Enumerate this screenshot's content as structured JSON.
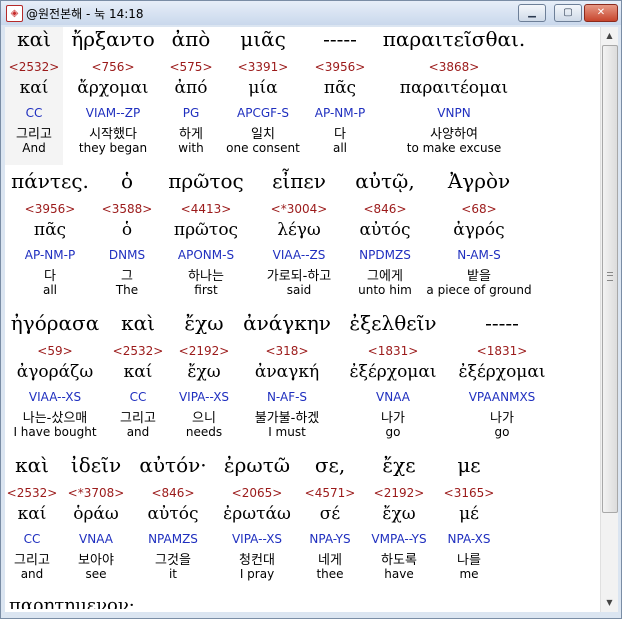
{
  "window": {
    "title": "@원전본해 - 눅 14:18"
  },
  "verses": [
    [
      {
        "greek": "καὶ",
        "num": "<2532>",
        "lemma": "καί",
        "parse": "CC",
        "korean": "그리고",
        "english": "And"
      },
      {
        "greek": "ἤρξαντο",
        "num": "<756>",
        "lemma": "ἄρχομαι",
        "parse": "VIAM--ZP",
        "korean": "시작했다",
        "english": "they began"
      },
      {
        "greek": "ἀπὸ",
        "num": "<575>",
        "lemma": "ἀπό",
        "parse": "PG",
        "korean": "하게",
        "english": "with"
      },
      {
        "greek": "μιᾶς",
        "num": "<3391>",
        "lemma": "μία",
        "parse": "APCGF-S",
        "korean": "일치",
        "english": "one consent"
      },
      {
        "greek": "-----",
        "num": "<3956>",
        "lemma": "πᾶς",
        "parse": "AP-NM-P",
        "korean": "다",
        "english": "all"
      },
      {
        "greek": "παραιτεῖσθαι.",
        "num": "<3868>",
        "lemma": "παραιτέομαι",
        "parse": "VNPN",
        "korean": "사양하여",
        "english": "to make excuse"
      }
    ],
    [
      {
        "greek": "πάντες.",
        "num": "<3956>",
        "lemma": "πᾶς",
        "parse": "AP-NM-P",
        "korean": "다",
        "english": "all"
      },
      {
        "greek": "ὁ",
        "num": "<3588>",
        "lemma": "ὁ",
        "parse": "DNMS",
        "korean": "그",
        "english": "The"
      },
      {
        "greek": "πρῶτος",
        "num": "<4413>",
        "lemma": "πρῶτος",
        "parse": "APONM-S",
        "korean": "하나는",
        "english": "first"
      },
      {
        "greek": "εἶπεν",
        "num": "<*3004>",
        "lemma": "λέγω",
        "parse": "VIAA--ZS",
        "korean": "가로되-하고",
        "english": "said"
      },
      {
        "greek": "αὐτῷ,",
        "num": "<846>",
        "lemma": "αὐτός",
        "parse": "NPDMZS",
        "korean": "그에게",
        "english": "unto him"
      },
      {
        "greek": "Ἀγρὸν",
        "num": "<68>",
        "lemma": "ἀγρός",
        "parse": "N-AM-S",
        "korean": "밭을",
        "english": "a piece of ground"
      }
    ],
    [
      {
        "greek": "ἠγόρασα",
        "num": "<59>",
        "lemma": "ἀγοράζω",
        "parse": "VIAA--XS",
        "korean": "나는-샀으매",
        "english": "I have bought"
      },
      {
        "greek": "καὶ",
        "num": "<2532>",
        "lemma": "καί",
        "parse": "CC",
        "korean": "그리고",
        "english": "and"
      },
      {
        "greek": "ἔχω",
        "num": "<2192>",
        "lemma": "ἔχω",
        "parse": "VIPA--XS",
        "korean": "으니",
        "english": "needs"
      },
      {
        "greek": "ἀνάγκην",
        "num": "<318>",
        "lemma": "ἀναγκή",
        "parse": "N-AF-S",
        "korean": "불가불-하겠",
        "english": "I must"
      },
      {
        "greek": "ἐξελθεῖν",
        "num": "<1831>",
        "lemma": "ἐξέρχομαι",
        "parse": "VNAA",
        "korean": "나가",
        "english": "go"
      },
      {
        "greek": "-----",
        "num": "<1831>",
        "lemma": "ἐξέρχομαι",
        "parse": "VPAANMXS",
        "korean": "나가",
        "english": "go"
      }
    ],
    [
      {
        "greek": "καὶ",
        "num": "<2532>",
        "lemma": "καί",
        "parse": "CC",
        "korean": "그리고",
        "english": "and"
      },
      {
        "greek": "ἰδεῖν",
        "num": "<*3708>",
        "lemma": "ὁράω",
        "parse": "VNAA",
        "korean": "보아야",
        "english": "see"
      },
      {
        "greek": "αὐτόν·",
        "num": "<846>",
        "lemma": "αὐτός",
        "parse": "NPAMZS",
        "korean": "그것을",
        "english": "it"
      },
      {
        "greek": "ἐρωτῶ",
        "num": "<2065>",
        "lemma": "ἐρωτάω",
        "parse": "VIPA--XS",
        "korean": "청컨대",
        "english": "I pray"
      },
      {
        "greek": "σε,",
        "num": "<4571>",
        "lemma": "σέ",
        "parse": "NPA-YS",
        "korean": "네게",
        "english": "thee"
      },
      {
        "greek": "ἔχε",
        "num": "<2192>",
        "lemma": "ἔχω",
        "parse": "VMPA--YS",
        "korean": "하도록",
        "english": "have"
      },
      {
        "greek": "με",
        "num": "<3165>",
        "lemma": "μέ",
        "parse": "NPA-XS",
        "korean": "나를",
        "english": "me"
      }
    ]
  ],
  "partial_next_line": "παρῃτημένον·"
}
